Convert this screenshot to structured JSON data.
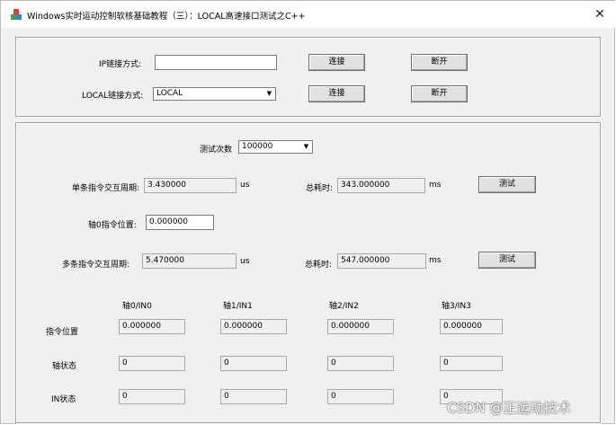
{
  "window": {
    "title": "Windows实时运动控制软核基础教程（三）：LOCAL高速接口测试之C++",
    "close_glyph": "✕"
  },
  "connect": {
    "ip_label": "IP链接方式:",
    "ip_value": "",
    "local_label": "LOCAL链接方式:",
    "local_value": "LOCAL",
    "connect_label": "连接",
    "disconnect_label": "断开"
  },
  "test": {
    "count_label": "测试次数",
    "count_value": "100000",
    "single_label": "单条指令交互周期:",
    "single_value": "3.430000",
    "single_unit": "us",
    "single_total_label": "总耗时:",
    "single_total_value": "343.000000",
    "single_total_unit": "ms",
    "test_button": "测试",
    "axis0_pos_label": "轴0指令位置:",
    "axis0_pos_value": "0.000000",
    "multi_label": "多条指令交互周期:",
    "multi_value": "5.470000",
    "multi_unit": "us",
    "multi_total_label": "总耗时:",
    "multi_total_value": "547.000000",
    "multi_total_unit": "ms"
  },
  "grid": {
    "columns": [
      "轴0/IN0",
      "轴1/IN1",
      "轴2/IN2",
      "轴3/IN3"
    ],
    "rows": [
      {
        "label": "指令位置",
        "values": [
          "0.000000",
          "0.000000",
          "0.000000",
          "0.000000"
        ]
      },
      {
        "label": "轴状态",
        "values": [
          "0",
          "0",
          "0",
          "0"
        ]
      },
      {
        "label": "IN状态",
        "values": [
          "0",
          "0",
          "0",
          "0"
        ]
      }
    ]
  },
  "watermark": "CSDN @正运动技术"
}
